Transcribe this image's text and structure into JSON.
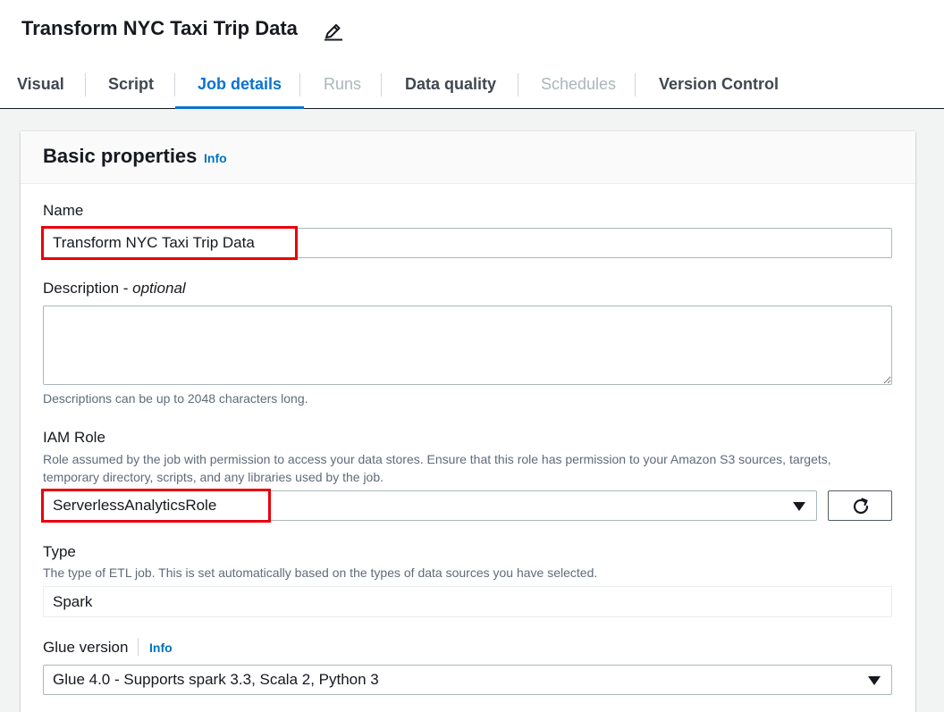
{
  "job": {
    "title": "Transform NYC Taxi Trip Data",
    "edit_icon": "pencil-icon"
  },
  "tabs": [
    {
      "label": "Visual",
      "state": "normal"
    },
    {
      "label": "Script",
      "state": "normal"
    },
    {
      "label": "Job details",
      "state": "active"
    },
    {
      "label": "Runs",
      "state": "disabled"
    },
    {
      "label": "Data quality",
      "state": "normal"
    },
    {
      "label": "Schedules",
      "state": "disabled"
    },
    {
      "label": "Version Control",
      "state": "normal"
    }
  ],
  "basic_properties": {
    "title": "Basic properties",
    "info": "Info",
    "name": {
      "label": "Name",
      "value": "Transform NYC Taxi Trip Data"
    },
    "description": {
      "label": "Description - ",
      "label_optional": "optional",
      "value": "",
      "help": "Descriptions can be up to 2048 characters long."
    },
    "iam_role": {
      "label": "IAM Role",
      "help": "Role assumed by the job with permission to access your data stores. Ensure that this role has permission to your Amazon S3 sources, targets, temporary directory, scripts, and any libraries used by the job.",
      "value": "ServerlessAnalyticsRole",
      "refresh_icon": "refresh-icon"
    },
    "type": {
      "label": "Type",
      "help": "The type of ETL job. This is set automatically based on the types of data sources you have selected.",
      "value": "Spark"
    },
    "glue_version": {
      "label": "Glue version",
      "info": "Info",
      "value": "Glue 4.0 - Supports spark 3.3, Scala 2, Python 3"
    }
  },
  "colors": {
    "accent": "#0972d3",
    "highlight": "#e8000b",
    "info_link": "#0073bb"
  }
}
